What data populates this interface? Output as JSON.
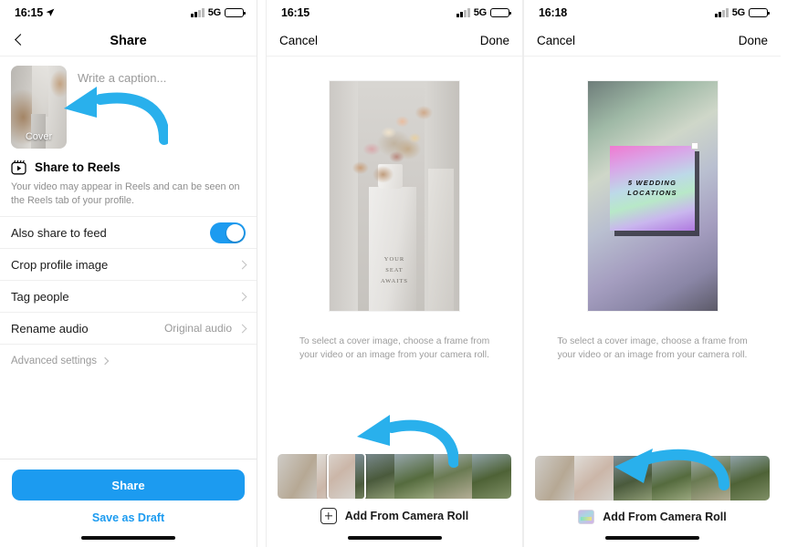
{
  "accent": "#1c9bf0",
  "arrow_color": "#29b0ec",
  "panel1": {
    "status": {
      "time": "16:15",
      "network": "5G",
      "location_icon": "location-arrow-icon"
    },
    "nav": {
      "back_icon": "chevron-left-icon",
      "title": "Share"
    },
    "cover": {
      "label": "Cover",
      "caption_placeholder": "Write a caption..."
    },
    "reels": {
      "icon": "reels-icon",
      "title": "Share to Reels",
      "description": "Your video may appear in Reels and can be seen on the Reels tab of your profile."
    },
    "rows": [
      {
        "label": "Also share to feed",
        "type": "toggle",
        "value": "on"
      },
      {
        "label": "Crop profile image",
        "type": "chevron",
        "value": ""
      },
      {
        "label": "Tag people",
        "type": "chevron",
        "value": ""
      },
      {
        "label": "Rename audio",
        "type": "chevron",
        "value": "Original audio"
      }
    ],
    "advanced": {
      "label": "Advanced settings"
    },
    "actions": {
      "share": "Share",
      "draft": "Save as Draft"
    }
  },
  "panel2": {
    "status": {
      "time": "16:15",
      "network": "5G"
    },
    "nav": {
      "cancel": "Cancel",
      "done": "Done"
    },
    "preview": {
      "type": "video-frame-flowers",
      "overlay_text": "YOUR\nSEAT\nAWAITS"
    },
    "hint": "To select a cover image, choose a frame from your video or an image from your camera roll.",
    "filmstrip": {
      "selected_index": 1,
      "frames": 6
    },
    "camera_roll": {
      "icon": "plus-box-icon",
      "label": "Add From Camera Roll"
    }
  },
  "panel3": {
    "status": {
      "time": "16:18",
      "network": "5G"
    },
    "nav": {
      "cancel": "Cancel",
      "done": "Done"
    },
    "preview": {
      "type": "gradient-cover",
      "overlay_text": "5 WEDDING\nLOCATIONS"
    },
    "hint": "To select a cover image, choose a frame from your video or an image from your camera roll.",
    "filmstrip": {
      "selected_index": -1,
      "frames": 6
    },
    "camera_roll": {
      "icon": "photo-thumbnail-icon",
      "label": "Add From Camera Roll"
    }
  }
}
